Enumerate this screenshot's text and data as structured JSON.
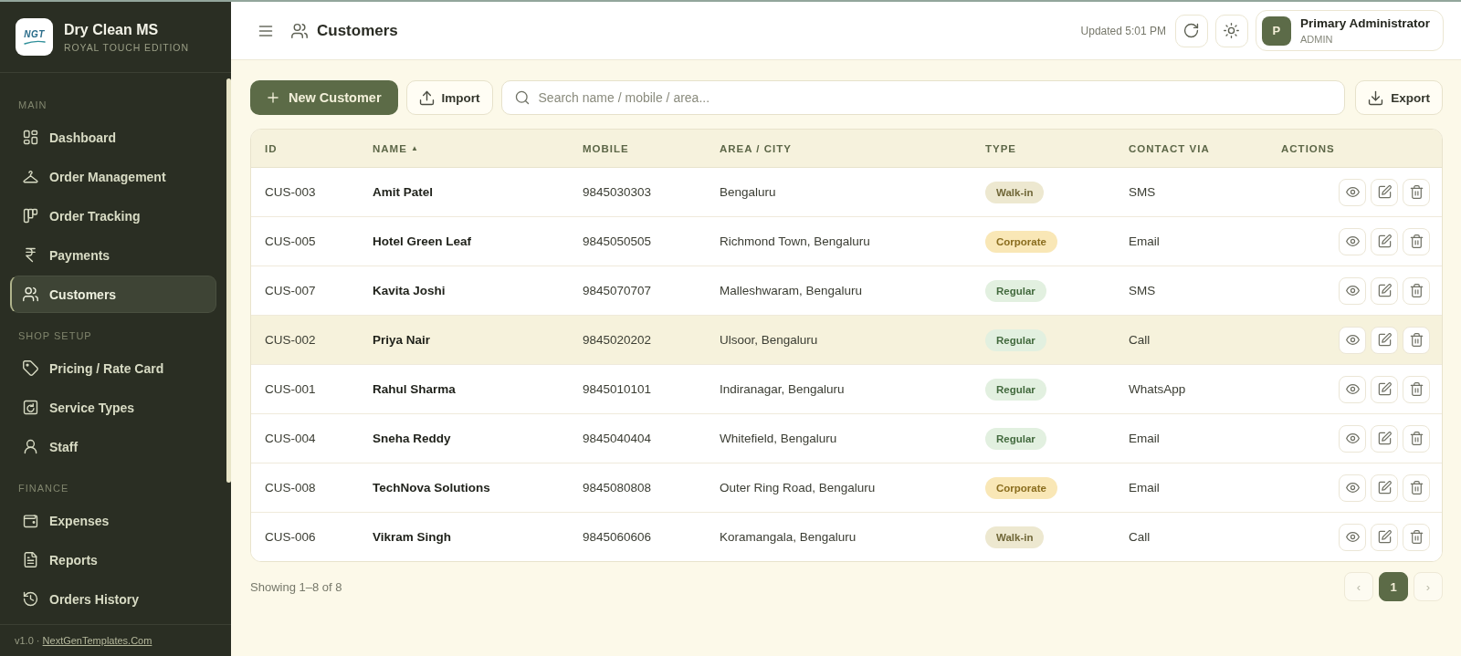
{
  "sidebar": {
    "brand": {
      "logo_text": "NGT",
      "title": "Dry Clean MS",
      "subtitle": "ROYAL TOUCH EDITION"
    },
    "sections": [
      {
        "label": "MAIN",
        "items": [
          {
            "label": "Dashboard",
            "selected": false
          },
          {
            "label": "Order Management",
            "selected": false
          },
          {
            "label": "Order Tracking",
            "selected": false
          },
          {
            "label": "Payments",
            "selected": false
          },
          {
            "label": "Customers",
            "selected": true
          }
        ]
      },
      {
        "label": "SHOP SETUP",
        "items": [
          {
            "label": "Pricing / Rate Card",
            "selected": false
          },
          {
            "label": "Service Types",
            "selected": false
          },
          {
            "label": "Staff",
            "selected": false
          }
        ]
      },
      {
        "label": "FINANCE",
        "items": [
          {
            "label": "Expenses",
            "selected": false
          },
          {
            "label": "Reports",
            "selected": false
          },
          {
            "label": "Orders History",
            "selected": false
          }
        ]
      }
    ],
    "footer": {
      "version": "v1.0 ·",
      "link": "NextGenTemplates.Com"
    }
  },
  "header": {
    "title": "Customers",
    "updated": "Updated 5:01 PM",
    "user": {
      "initial": "P",
      "name": "Primary Administrator",
      "role": "ADMIN"
    }
  },
  "toolbar": {
    "new_button": "New Customer",
    "import_button": "Import",
    "search": {
      "placeholder": "Search name / mobile / area..."
    },
    "export_button": "Export"
  },
  "table": {
    "columns": [
      {
        "label": "ID"
      },
      {
        "label": "NAME",
        "sort": "▲"
      },
      {
        "label": "MOBILE"
      },
      {
        "label": "AREA / CITY"
      },
      {
        "label": "TYPE"
      },
      {
        "label": "CONTACT VIA"
      },
      {
        "label": "ACTIONS"
      }
    ],
    "rows": [
      {
        "id": "CUS-003",
        "name": "Amit Patel",
        "mobile": "9845030303",
        "area": "Bengaluru",
        "type": {
          "label": "Walk-in",
          "color": "#ede8d0"
        },
        "contact": "SMS",
        "selected": false
      },
      {
        "id": "CUS-005",
        "name": "Hotel Green Leaf",
        "mobile": "9845050505",
        "area": "Richmond Town, Bengaluru",
        "type": {
          "label": "Corporate",
          "color": "#f9e7b6"
        },
        "contact": "Email",
        "selected": false
      },
      {
        "id": "CUS-007",
        "name": "Kavita Joshi",
        "mobile": "9845070707",
        "area": "Malleshwaram, Bengaluru",
        "type": {
          "label": "Regular",
          "color": "#e2f0e0"
        },
        "contact": "SMS",
        "selected": false
      },
      {
        "id": "CUS-002",
        "name": "Priya Nair",
        "mobile": "9845020202",
        "area": "Ulsoor, Bengaluru",
        "type": {
          "label": "Regular",
          "color": "#e2f0e0"
        },
        "contact": "Call",
        "selected": true
      },
      {
        "id": "CUS-001",
        "name": "Rahul Sharma",
        "mobile": "9845010101",
        "area": "Indiranagar, Bengaluru",
        "type": {
          "label": "Regular",
          "color": "#e2f0e0"
        },
        "contact": "WhatsApp",
        "selected": false
      },
      {
        "id": "CUS-004",
        "name": "Sneha Reddy",
        "mobile": "9845040404",
        "area": "Whitefield, Bengaluru",
        "type": {
          "label": "Regular",
          "color": "#e2f0e0"
        },
        "contact": "Email",
        "selected": false
      },
      {
        "id": "CUS-008",
        "name": "TechNova Solutions",
        "mobile": "9845080808",
        "area": "Outer Ring Road, Bengaluru",
        "type": {
          "label": "Corporate",
          "color": "#f9e7b6"
        },
        "contact": "Email",
        "selected": false
      },
      {
        "id": "CUS-006",
        "name": "Vikram Singh",
        "mobile": "9845060606",
        "area": "Koramangala, Bengaluru",
        "type": {
          "label": "Walk-in",
          "color": "#ede8d0"
        },
        "contact": "Call",
        "selected": false
      }
    ]
  },
  "pagination": {
    "summary": "Showing 1–8 of 8",
    "prev": {
      "label": "‹",
      "disabled": true
    },
    "pages": [
      {
        "label": "1",
        "selected": true
      }
    ],
    "next": {
      "label": "›",
      "disabled": true
    }
  }
}
